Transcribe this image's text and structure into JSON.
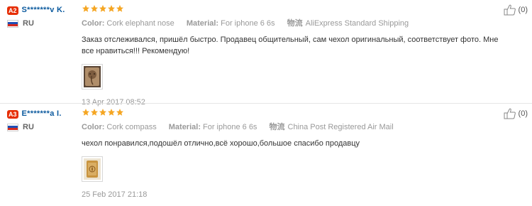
{
  "colors": {
    "level_badge": "#e62e04",
    "username": "#0c5a9e",
    "star": "#f5a623",
    "meta": "#999999"
  },
  "reviews": [
    {
      "level": "A2",
      "username": "S*******v K.",
      "country": "RU",
      "rating": 5,
      "color_label": "Color:",
      "color_value": "Cork elephant nose",
      "material_label": "Material:",
      "material_value": "For iphone 6 6s",
      "shipping_label": "物流",
      "shipping_value": "AliExpress Standard Shipping",
      "text": "Заказ отслеживался, пришёл быстро. Продавец общительный, сам чехол оригинальный, соответствует фото. Мне все нравиться!!! Рекомендую!",
      "date": "13 Apr 2017 08:52",
      "helpful_count": "(0)"
    },
    {
      "level": "A3",
      "username": "E*******a I.",
      "country": "RU",
      "rating": 5,
      "color_label": "Color:",
      "color_value": "Cork compass",
      "material_label": "Material:",
      "material_value": "For iphone 6 6s",
      "shipping_label": "物流",
      "shipping_value": "China Post Registered Air Mail",
      "text": "чехол понравился,подошёл отлично,всё хорошо,большое спасибо продавцу",
      "date": "25 Feb 2017 21:18",
      "helpful_count": "(0)"
    }
  ]
}
